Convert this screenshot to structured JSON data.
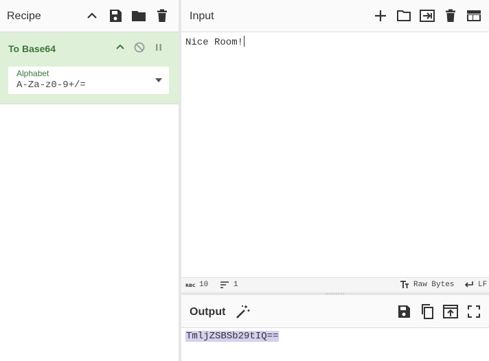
{
  "recipe": {
    "title": "Recipe",
    "operation": {
      "name": "To Base64",
      "alphabet_label": "Alphabet",
      "alphabet_value": "A-Za-z0-9+/="
    }
  },
  "input": {
    "title": "Input",
    "text": "Nice Room!",
    "status": {
      "length": "10",
      "lines": "1",
      "format": "Raw Bytes",
      "eol": "LF"
    }
  },
  "output": {
    "title": "Output",
    "text": "TmljZSBSb29tIQ=="
  },
  "colors": {
    "operation_bg": "#dff0d8",
    "operation_text": "#3c763d",
    "output_highlight": "#d3d0f0"
  },
  "icons": {
    "recipe_header": [
      "chevron-up-icon",
      "save-icon",
      "folder-icon",
      "trash-icon"
    ],
    "operation": [
      "chevron-up-icon",
      "disable-icon",
      "pause-icon"
    ],
    "input_header": [
      "plus-icon",
      "folder-open-icon",
      "import-icon",
      "trash-icon",
      "layout-icon"
    ],
    "output_header": [
      "magic-wand-icon",
      "save-icon",
      "copy-icon",
      "replace-input-icon",
      "fullscreen-icon"
    ]
  }
}
